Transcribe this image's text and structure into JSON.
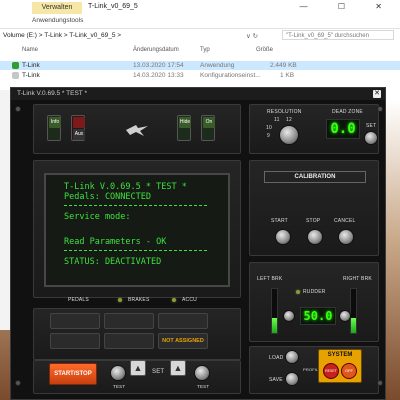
{
  "explorer": {
    "tool_tab": "Verwalten",
    "title": "T-Link_v0_69_5",
    "window_buttons": "— ☐ ✕",
    "ribbon_tab": "Anwendungstools",
    "breadcrumb": "Volume (E:)  >  T-Link  >  T-Link_v0_69_5  >",
    "nav_arrows": "∨  ↻",
    "search_placeholder": "\"T-Link_v0_69_5\" durchsuchen",
    "columns": {
      "name": "Name",
      "date": "Änderungsdatum",
      "type": "Typ",
      "size": "Größe"
    },
    "files": [
      {
        "name": "T-Link",
        "date": "13.03.2020 17:54",
        "type": "Anwendung",
        "size": "2.449 KB",
        "selected": true,
        "icon_color": "#2f9e2f"
      },
      {
        "name": "T-Link",
        "date": "14.03.2020 13:33",
        "type": "Konfigurationseinst...",
        "size": "1 KB",
        "selected": false,
        "icon_color": "#c6c6c6"
      }
    ]
  },
  "tlink": {
    "title": "T-Link V.0.69.5 * TEST *",
    "close_glyph": "✕",
    "switches": {
      "info": "Info",
      "aux": "Aux",
      "hide": "Hide",
      "on": "On"
    },
    "logo_icon": "jet-logo-icon",
    "resolution": {
      "label": "RESOLUTION",
      "marks": [
        "11",
        "12",
        "10",
        "9"
      ]
    },
    "deadzone": {
      "label": "DEAD ZONE",
      "value": "0.0",
      "set_label": "SET"
    },
    "lcd_lines": {
      "line1": "T-Link V.0.69.5 * TEST *",
      "line2": "Pedals: CONNECTED",
      "line3": "Service mode:",
      "line4": "Read Parameters - OK",
      "line5": "STATUS: DEACTIVATED"
    },
    "calibration": {
      "label": "CALIBRATION",
      "start": "START",
      "stop": "STOP",
      "cancel": "CANCEL"
    },
    "indicators": {
      "pedals": "PEDALS",
      "brakes": "BRAKES",
      "accu": "ACCU"
    },
    "not_assigned": "NOT ASSIGNED",
    "brakes_panel": {
      "left": "LEFT BRK",
      "right": "RIGHT BRK",
      "rudder": "RUDDER",
      "value": "50.0",
      "left_fill": 0.35,
      "right_fill": 0.35
    },
    "start_stop": "START/STOP",
    "test_left": "TEST",
    "set_center": "SET",
    "test_right": "TEST",
    "profile": {
      "load": "LOAD",
      "save": "SAVE",
      "profile": "PROFILE"
    },
    "system": {
      "label": "SYSTEM",
      "reset": "RESET",
      "off": "OFF"
    },
    "colors": {
      "lcd_green": "#3ee23e",
      "segment_green": "#39ff14",
      "orange": "#e0571c",
      "amber": "#e8a200"
    }
  }
}
